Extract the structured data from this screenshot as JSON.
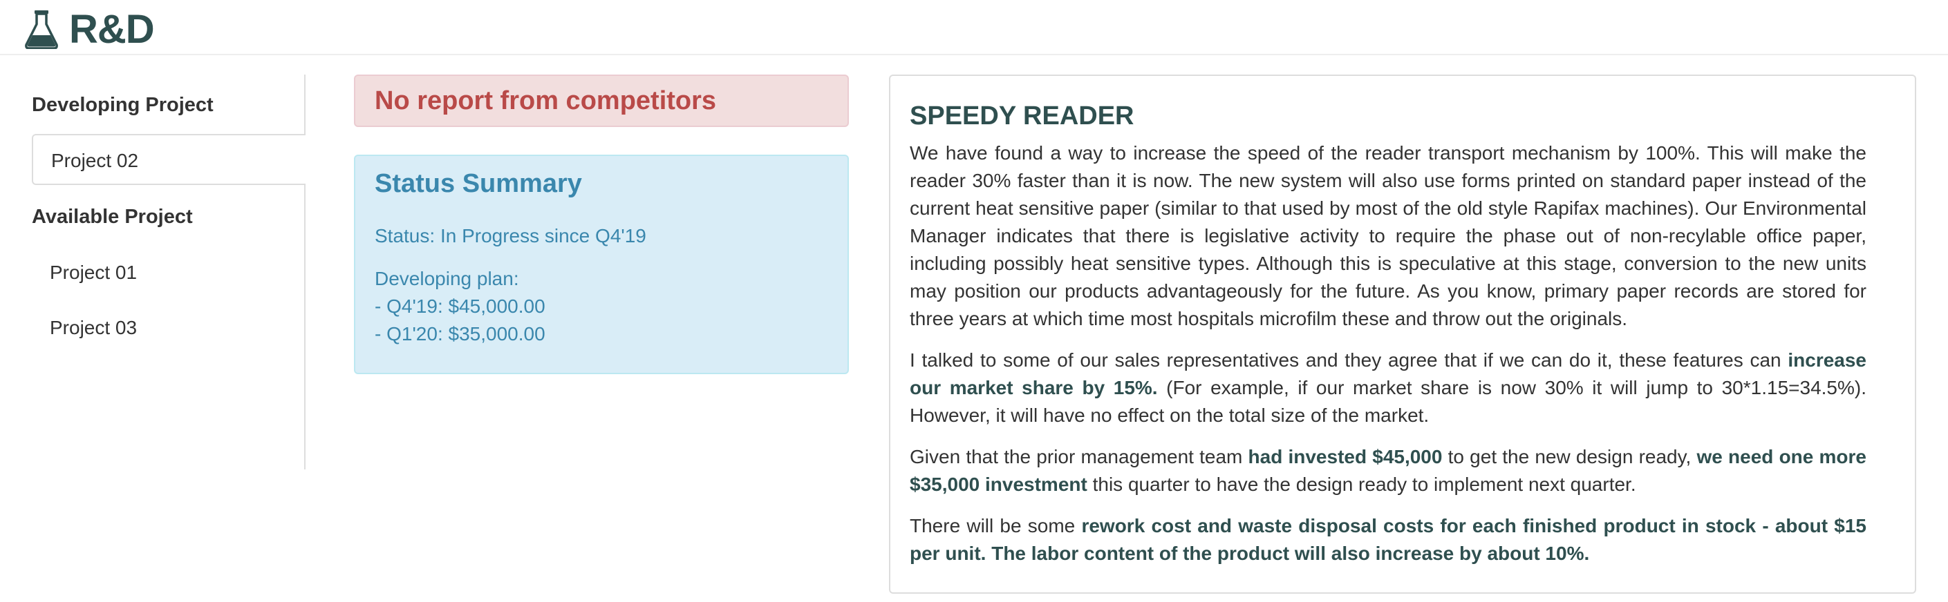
{
  "header": {
    "title": "R&D",
    "icon": "flask-icon"
  },
  "sidebar": {
    "developing_heading": "Developing Project",
    "developing_items": [
      {
        "label": "Project 02",
        "active": true
      }
    ],
    "available_heading": "Available Project",
    "available_items": [
      {
        "label": "Project 01"
      },
      {
        "label": "Project 03"
      }
    ]
  },
  "alert": {
    "text": "No report from competitors",
    "color": "#b94a48"
  },
  "status_summary": {
    "title": "Status Summary",
    "status": "Status: In Progress since Q4'19",
    "plan_label": "Developing plan:",
    "plan_items": [
      "- Q4'19: $45,000.00",
      "- Q1'20: $35,000.00"
    ],
    "color": "#3a87ad"
  },
  "report": {
    "title": "SPEEDY READER",
    "p1": "We have found a way to increase the speed of the reader transport mechanism by 100%. This will make the reader 30% faster than it is now. The new system will also use forms printed on standard paper instead of the current heat sensitive paper (similar to that used by most of the old style Rapifax machines). Our Environmental Manager indicates that there is legislative activity to require the phase out of non-recylable office paper, including possibly heat sensitive types. Although this is speculative at this stage, conversion to the new units may position our products advantageously for the future. As you know, primary paper records are stored for three years at which time most hospitals microfilm these and throw out the originals.",
    "p2_a": "I talked to some of our sales representatives and they agree that if we can do it, these features can ",
    "p2_b": "increase our market share by 15%.",
    "p2_c": " (For example, if our market share is now 30% it will jump to 30*1.15=34.5%). However, it will have no effect on the total size of the market.",
    "p3_a": "Given that the prior management team ",
    "p3_b": "had invested $45,000",
    "p3_c": " to get the new design ready, ",
    "p3_d": "we need one more $35,000 investment",
    "p3_e": " this quarter to have the design ready to implement next quarter.",
    "p4_a": "There will be some ",
    "p4_b": "rework cost and waste disposal costs for each finished product in stock - about $15 per unit. The labor content of the product will also increase by about 10%."
  }
}
